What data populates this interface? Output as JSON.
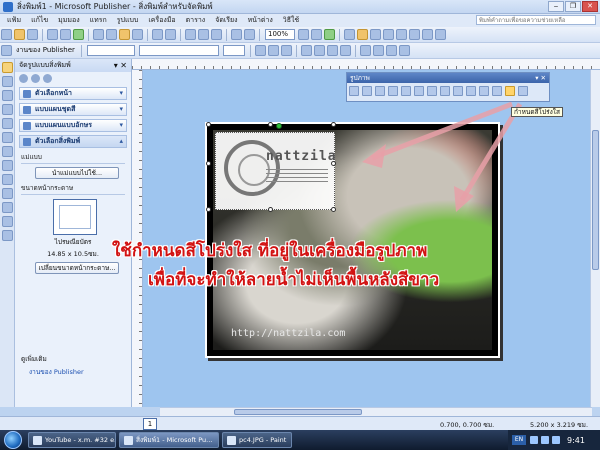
{
  "window": {
    "title": "สิ่งพิมพ์1 - Microsoft Publisher - สิ่งพิมพ์สำหรับจัดพิมพ์",
    "help_placeholder": "พิมพ์คำถามเพื่อขอความช่วยเหลือ"
  },
  "menu": [
    "แฟ้ม",
    "แก้ไข",
    "มุมมอง",
    "แทรก",
    "รูปแบบ",
    "เครื่องมือ",
    "ตาราง",
    "จัดเรียง",
    "หน้าต่าง",
    "วิธีใช้"
  ],
  "toolbar": {
    "zoom": "100%",
    "tasks_label": "งานของ Publisher"
  },
  "taskpane": {
    "title": "จัดรูปแบบสิ่งพิมพ์",
    "sections": [
      {
        "label": "ตัวเลือกหน้า",
        "open": false
      },
      {
        "label": "แบบแผนชุดสี",
        "open": false
      },
      {
        "label": "แบบแผนแบบอักษร",
        "open": false
      },
      {
        "label": "ตัวเลือกสิ่งพิมพ์",
        "open": true
      }
    ],
    "template_label": "แม่แบบ",
    "template_button": "นำแม่แบบไปใช้...",
    "paper_size_label": "ขนาดหน้ากระดาษ",
    "paper_name": "ไปรษณียบัตร",
    "paper_dims": "14.85 x 10.5ซม.",
    "change_paper_button": "เปลี่ยนขนาดหน้ากระดาษ...",
    "see_also": "ดูเพิ่มเติม",
    "see_also_link": "งานของ Publisher"
  },
  "picture_toolbar": {
    "title": "รูปภาพ",
    "tooltip": "กำหนดสีโปร่งใส"
  },
  "canvas": {
    "stamp_text": "nattzila",
    "url_text": "http://nattzila.com",
    "caption_line1": "ใช้กำหนดสีโปร่งใส ที่อยู่ในเครื่องมือรูปภาพ",
    "caption_line2": "เพื่อที่จะทำให้ลายน้ำไม่เห็นพื้นหลังสีขาว"
  },
  "status": {
    "page": "1",
    "position": "0.700, 0.700 ซม.",
    "size": "5.200 x 3.219 ซม."
  },
  "taskbar": {
    "tasks": [
      {
        "label": "YouTube - x.m. #32 e...",
        "active": false
      },
      {
        "label": "สิ่งพิมพ์1 - Microsoft Pu...",
        "active": true
      },
      {
        "label": "pc4.JPG - Paint",
        "active": false
      }
    ],
    "lang": "EN",
    "clock": "9:41"
  },
  "colors": {
    "caption": "#d21313",
    "arrow": "#e8a0a8",
    "workspace": "#9ec5ef"
  }
}
